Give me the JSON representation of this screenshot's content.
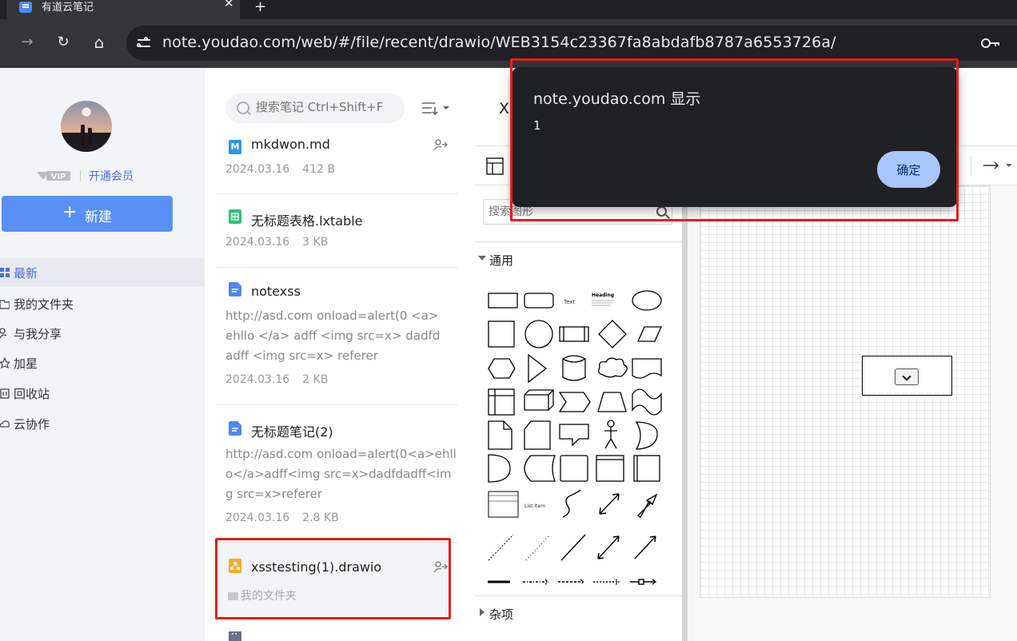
{
  "browser": {
    "tab_title": "有道云笔记",
    "tab_close": "✕",
    "newtab": "+",
    "back": "←",
    "forward": "→",
    "reload": "↻",
    "home": "⌂",
    "url": "note.youdao.com/web/#/file/recent/drawio/WEB3154c23367fa8abdafb8787a6553726a/"
  },
  "sidebar": {
    "vip_badge": "VIP",
    "vip_link": "开通会员",
    "new_button": {
      "icon": "+",
      "label": "新建"
    },
    "nav": [
      {
        "label": "最新",
        "icon": "grid-icon",
        "active": true
      },
      {
        "label": "我的文件夹",
        "icon": "folder-icon",
        "active": false
      },
      {
        "label": "与我分享",
        "icon": "share-user-icon",
        "active": false
      },
      {
        "label": "加星",
        "icon": "star-icon",
        "active": false
      },
      {
        "label": "回收站",
        "icon": "trash-icon",
        "active": false
      },
      {
        "label": "云协作",
        "icon": "cloud-icon",
        "active": false
      }
    ]
  },
  "filelist": {
    "search_placeholder": "搜索笔记 Ctrl+Shift+F",
    "files": [
      {
        "name": "mkdwon.md",
        "type": "markdown",
        "icon_letter": "M",
        "date": "2024.03.16",
        "size": "412 B",
        "shared": true
      },
      {
        "name": "无标题表格.lxtable",
        "type": "table",
        "date": "2024.03.16",
        "size": "3 KB",
        "shared": false
      },
      {
        "name": "notexss",
        "type": "note",
        "snippet": "http://asd.com onload=alert(0 <a> ehllo </a> adff <img src=x> dadfd adff <img src=x> referer",
        "date": "2024.03.16",
        "size": "2 KB",
        "shared": false
      },
      {
        "name": "无标题笔记(2)",
        "type": "note",
        "snippet": "http://asd.com onload=alert(0<a>ehllo</a>adff<img src=x>dadfdadff<img src=x>referer",
        "date": "2024.03.16",
        "size": "2.8 KB",
        "shared": false
      },
      {
        "name": "xsstesting(1).drawio",
        "type": "drawio",
        "folder": "我的文件夹",
        "shared": true,
        "selected": true
      }
    ]
  },
  "drawio": {
    "title_partial": "X",
    "shape_search_placeholder": "搜索图形",
    "section_general": "通用",
    "section_misc": "杂项",
    "palette_labels": {
      "text": "Text",
      "heading": "Heading",
      "list_item": "List Item"
    }
  },
  "dialog": {
    "title": "note.youdao.com 显示",
    "message": "1",
    "ok_label": "确定"
  },
  "colors": {
    "accent": "#5a8ff6",
    "highlight_box": "#ea1c1c",
    "dialog_bg": "#202124",
    "dialog_button": "#a8c7fa"
  }
}
